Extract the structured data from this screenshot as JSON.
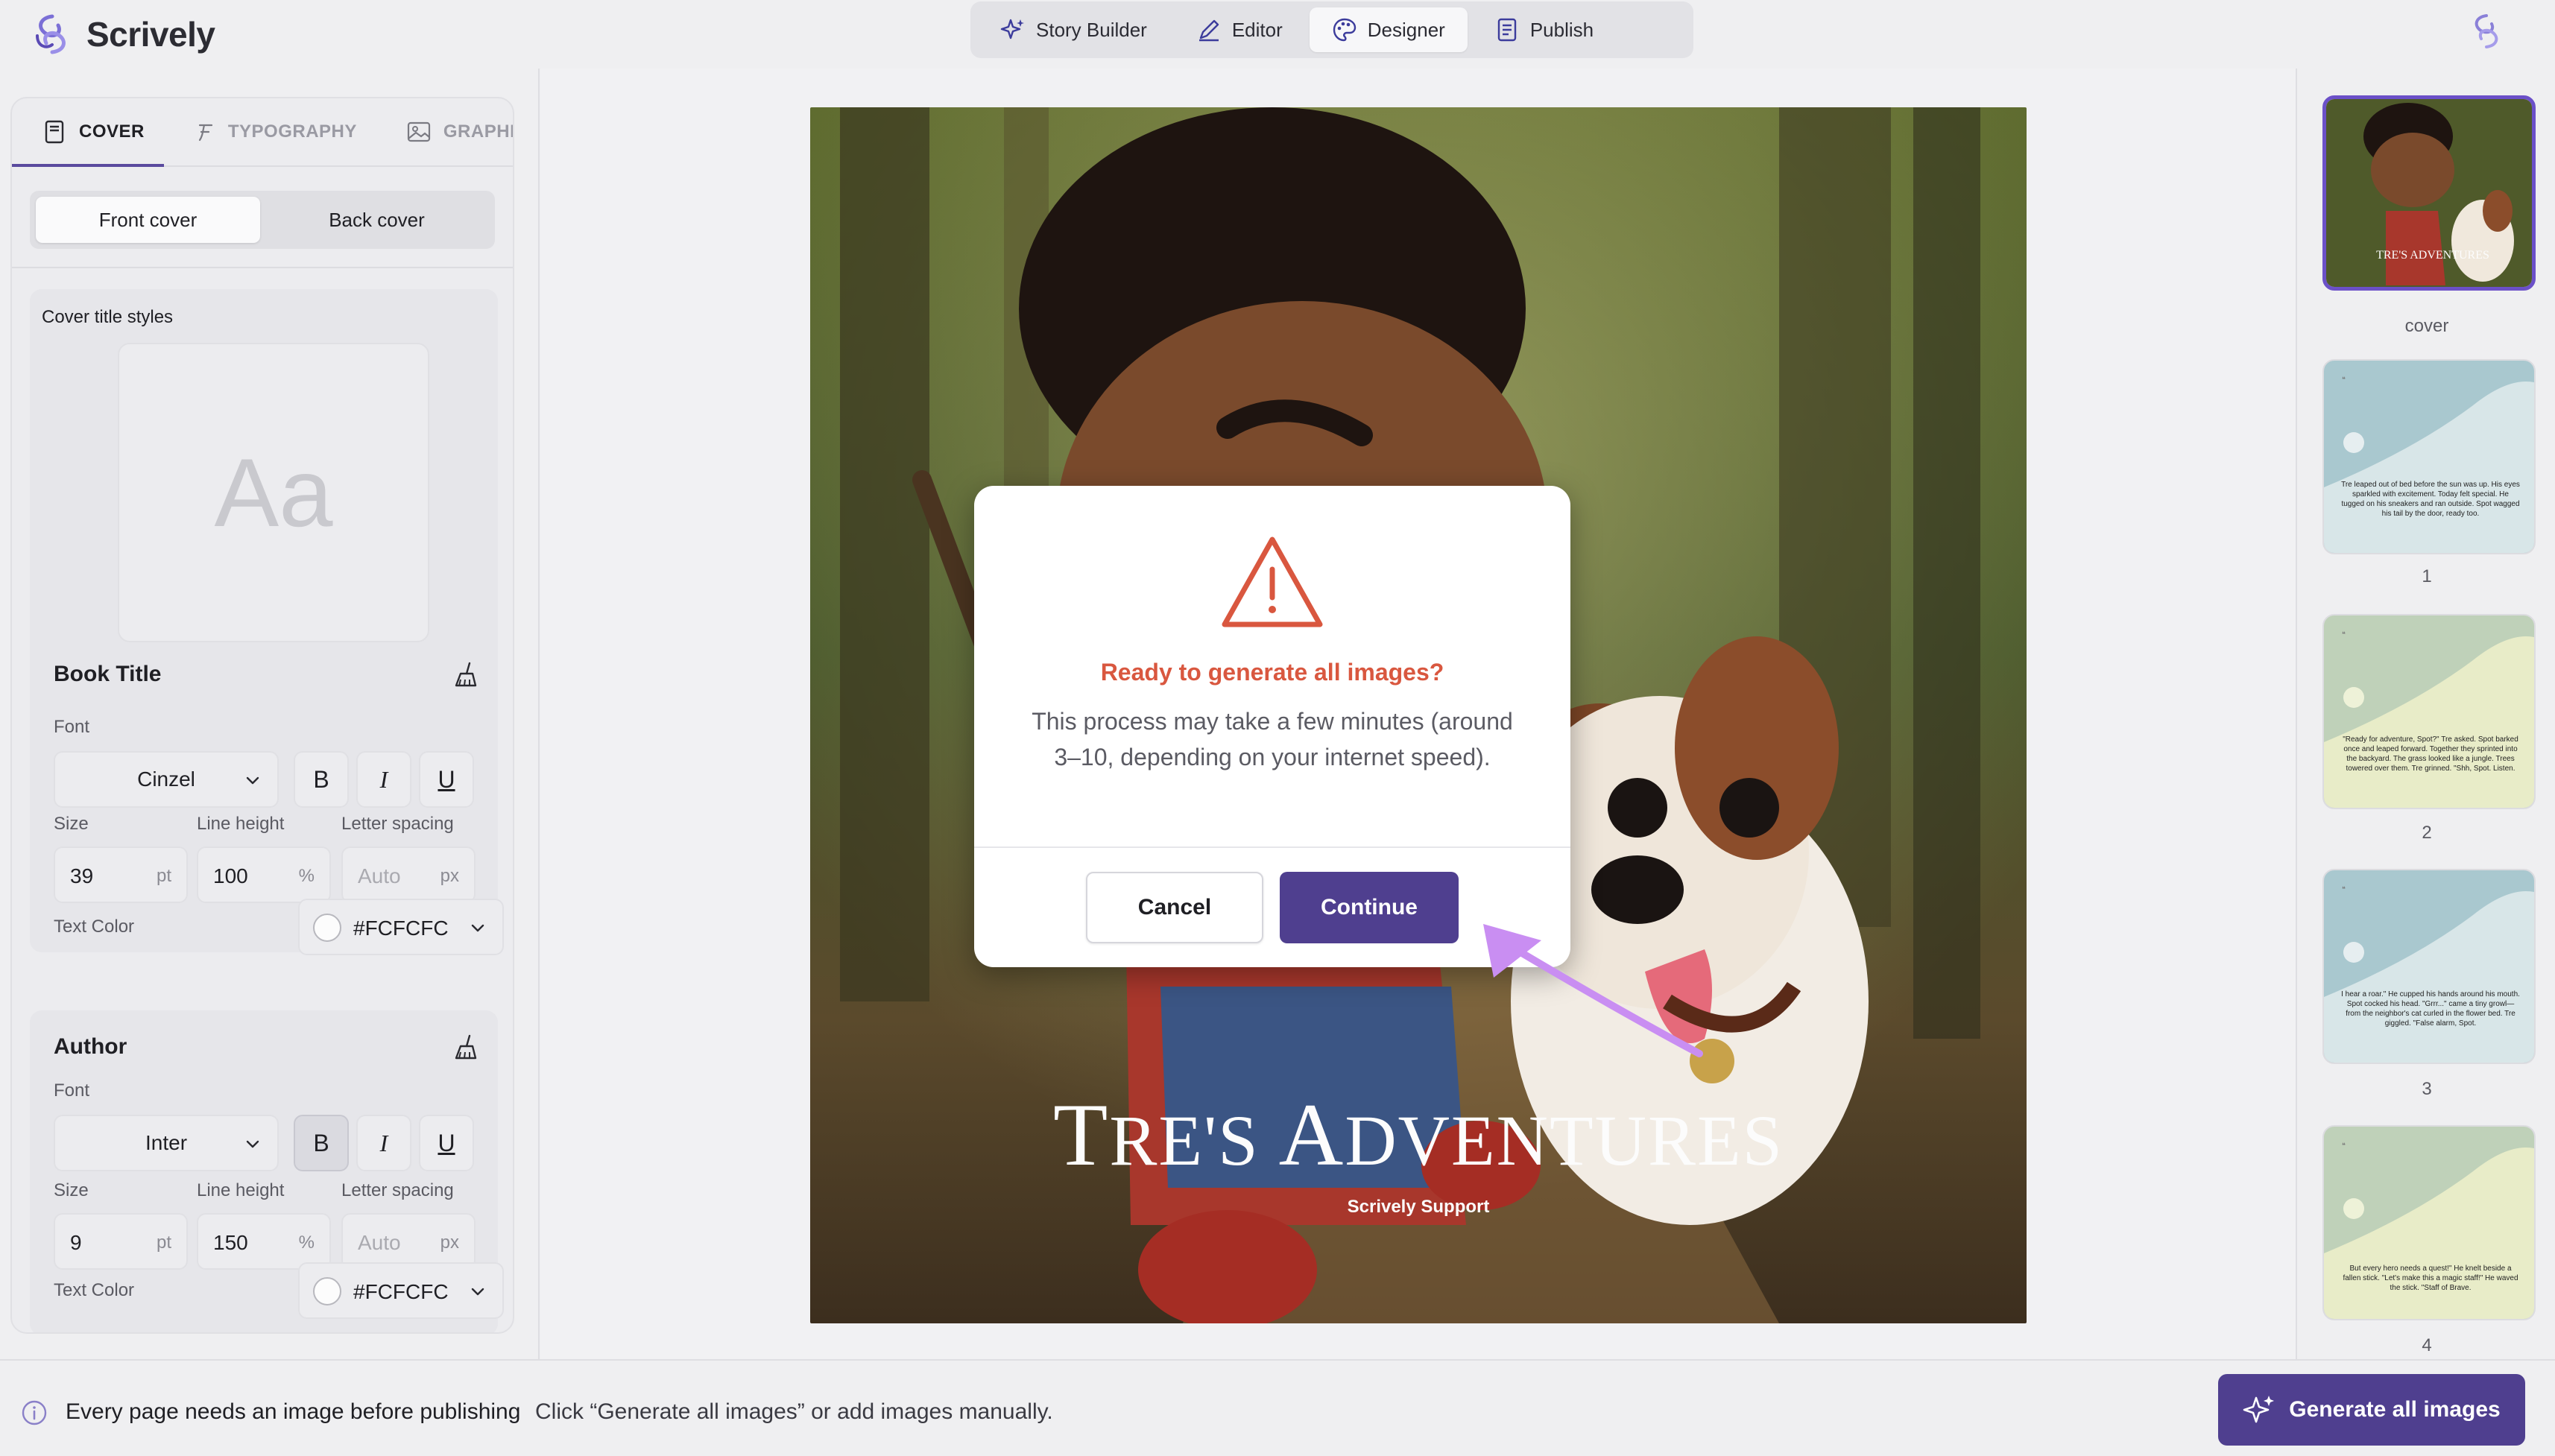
{
  "app": {
    "name": "Scrively"
  },
  "nav": {
    "tabs": [
      {
        "label": "Story Builder",
        "icon": "sparkles-icon"
      },
      {
        "label": "Editor",
        "icon": "pen-icon"
      },
      {
        "label": "Designer",
        "icon": "palette-icon",
        "active": true
      },
      {
        "label": "Publish",
        "icon": "document-icon"
      }
    ]
  },
  "left_panel": {
    "tabs": [
      {
        "label": "COVER",
        "active": true
      },
      {
        "label": "TYPOGRAPHY"
      },
      {
        "label": "GRAPHICS"
      }
    ],
    "segments": [
      {
        "label": "Front cover",
        "active": true
      },
      {
        "label": "Back cover"
      }
    ],
    "cover_title_styles_label": "Cover title styles",
    "preview_text": "Aa",
    "book_title": {
      "heading": "Book Title",
      "font_label": "Font",
      "font": "Cinzel",
      "bold": false,
      "italic": false,
      "underline": false,
      "size_label": "Size",
      "size": "39",
      "size_unit": "pt",
      "line_height_label": "Line height",
      "line_height": "100",
      "line_height_unit": "%",
      "letter_spacing_label": "Letter spacing",
      "letter_spacing_placeholder": "Auto",
      "letter_spacing_unit": "px",
      "text_color_label": "Text Color",
      "text_color": "#FCFCFC"
    },
    "author": {
      "heading": "Author",
      "font_label": "Font",
      "font": "Inter",
      "bold": true,
      "italic": false,
      "underline": false,
      "size_label": "Size",
      "size": "9",
      "size_unit": "pt",
      "line_height_label": "Line height",
      "line_height": "150",
      "line_height_unit": "%",
      "letter_spacing_label": "Letter spacing",
      "letter_spacing_placeholder": "Auto",
      "letter_spacing_unit": "px",
      "text_color_label": "Text Color",
      "text_color": "#FCFCFC"
    }
  },
  "cover": {
    "title_first": "T",
    "title_rest": "RE'S ",
    "title_first2": "A",
    "title_rest2": "DVENTURES",
    "author": "Scrively Support"
  },
  "modal": {
    "title": "Ready to generate all images?",
    "body": "This process may take a few minutes (around 3–10, depending on your internet speed).",
    "cancel_label": "Cancel",
    "continue_label": "Continue"
  },
  "pages": [
    {
      "label": "cover",
      "selected": true
    },
    {
      "label": "1",
      "text": "Tre leaped out of bed before the sun was up. His eyes sparkled with excitement. Today felt special. He tugged on his sneakers and ran outside. Spot wagged his tail by the door, ready too."
    },
    {
      "label": "2",
      "text": "\"Ready for adventure, Spot?\" Tre asked. Spot barked once and leaped forward. Together they sprinted into the backyard. The grass looked like a jungle. Trees towered over them. Tre grinned. \"Shh, Spot. Listen."
    },
    {
      "label": "3",
      "text": "I hear a roar.\" He cupped his hands around his mouth. Spot cocked his head. \"Grrr...\" came a tiny growl—from the neighbor's cat curled in the flower bed. Tre giggled. \"False alarm, Spot."
    },
    {
      "label": "4",
      "text": "But every hero needs a quest!\" He knelt beside a fallen stick. \"Let's make this a magic staff!\" He waved the stick. \"Staff of Brave."
    }
  ],
  "bottom": {
    "message": "Every page needs an image before publishing",
    "hint": "Click “Generate all images” or add images manually.",
    "generate_label": "Generate all images"
  },
  "colors": {
    "accent": "#4F3F8F",
    "warning": "#D9573F",
    "selected_thumb": "#6B50C8"
  }
}
